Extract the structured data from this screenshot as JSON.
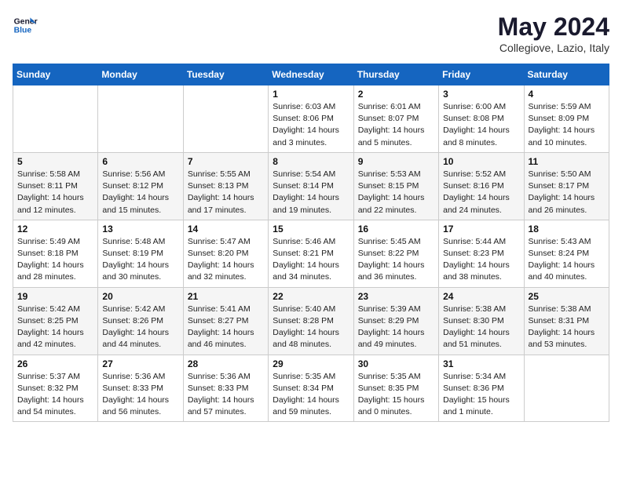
{
  "header": {
    "logo_line1": "General",
    "logo_line2": "Blue",
    "month_title": "May 2024",
    "subtitle": "Collegiove, Lazio, Italy"
  },
  "weekdays": [
    "Sunday",
    "Monday",
    "Tuesday",
    "Wednesday",
    "Thursday",
    "Friday",
    "Saturday"
  ],
  "weeks": [
    [
      {
        "day": "",
        "sunrise": "",
        "sunset": "",
        "daylight": ""
      },
      {
        "day": "",
        "sunrise": "",
        "sunset": "",
        "daylight": ""
      },
      {
        "day": "",
        "sunrise": "",
        "sunset": "",
        "daylight": ""
      },
      {
        "day": "1",
        "sunrise": "Sunrise: 6:03 AM",
        "sunset": "Sunset: 8:06 PM",
        "daylight": "Daylight: 14 hours and 3 minutes."
      },
      {
        "day": "2",
        "sunrise": "Sunrise: 6:01 AM",
        "sunset": "Sunset: 8:07 PM",
        "daylight": "Daylight: 14 hours and 5 minutes."
      },
      {
        "day": "3",
        "sunrise": "Sunrise: 6:00 AM",
        "sunset": "Sunset: 8:08 PM",
        "daylight": "Daylight: 14 hours and 8 minutes."
      },
      {
        "day": "4",
        "sunrise": "Sunrise: 5:59 AM",
        "sunset": "Sunset: 8:09 PM",
        "daylight": "Daylight: 14 hours and 10 minutes."
      }
    ],
    [
      {
        "day": "5",
        "sunrise": "Sunrise: 5:58 AM",
        "sunset": "Sunset: 8:11 PM",
        "daylight": "Daylight: 14 hours and 12 minutes."
      },
      {
        "day": "6",
        "sunrise": "Sunrise: 5:56 AM",
        "sunset": "Sunset: 8:12 PM",
        "daylight": "Daylight: 14 hours and 15 minutes."
      },
      {
        "day": "7",
        "sunrise": "Sunrise: 5:55 AM",
        "sunset": "Sunset: 8:13 PM",
        "daylight": "Daylight: 14 hours and 17 minutes."
      },
      {
        "day": "8",
        "sunrise": "Sunrise: 5:54 AM",
        "sunset": "Sunset: 8:14 PM",
        "daylight": "Daylight: 14 hours and 19 minutes."
      },
      {
        "day": "9",
        "sunrise": "Sunrise: 5:53 AM",
        "sunset": "Sunset: 8:15 PM",
        "daylight": "Daylight: 14 hours and 22 minutes."
      },
      {
        "day": "10",
        "sunrise": "Sunrise: 5:52 AM",
        "sunset": "Sunset: 8:16 PM",
        "daylight": "Daylight: 14 hours and 24 minutes."
      },
      {
        "day": "11",
        "sunrise": "Sunrise: 5:50 AM",
        "sunset": "Sunset: 8:17 PM",
        "daylight": "Daylight: 14 hours and 26 minutes."
      }
    ],
    [
      {
        "day": "12",
        "sunrise": "Sunrise: 5:49 AM",
        "sunset": "Sunset: 8:18 PM",
        "daylight": "Daylight: 14 hours and 28 minutes."
      },
      {
        "day": "13",
        "sunrise": "Sunrise: 5:48 AM",
        "sunset": "Sunset: 8:19 PM",
        "daylight": "Daylight: 14 hours and 30 minutes."
      },
      {
        "day": "14",
        "sunrise": "Sunrise: 5:47 AM",
        "sunset": "Sunset: 8:20 PM",
        "daylight": "Daylight: 14 hours and 32 minutes."
      },
      {
        "day": "15",
        "sunrise": "Sunrise: 5:46 AM",
        "sunset": "Sunset: 8:21 PM",
        "daylight": "Daylight: 14 hours and 34 minutes."
      },
      {
        "day": "16",
        "sunrise": "Sunrise: 5:45 AM",
        "sunset": "Sunset: 8:22 PM",
        "daylight": "Daylight: 14 hours and 36 minutes."
      },
      {
        "day": "17",
        "sunrise": "Sunrise: 5:44 AM",
        "sunset": "Sunset: 8:23 PM",
        "daylight": "Daylight: 14 hours and 38 minutes."
      },
      {
        "day": "18",
        "sunrise": "Sunrise: 5:43 AM",
        "sunset": "Sunset: 8:24 PM",
        "daylight": "Daylight: 14 hours and 40 minutes."
      }
    ],
    [
      {
        "day": "19",
        "sunrise": "Sunrise: 5:42 AM",
        "sunset": "Sunset: 8:25 PM",
        "daylight": "Daylight: 14 hours and 42 minutes."
      },
      {
        "day": "20",
        "sunrise": "Sunrise: 5:42 AM",
        "sunset": "Sunset: 8:26 PM",
        "daylight": "Daylight: 14 hours and 44 minutes."
      },
      {
        "day": "21",
        "sunrise": "Sunrise: 5:41 AM",
        "sunset": "Sunset: 8:27 PM",
        "daylight": "Daylight: 14 hours and 46 minutes."
      },
      {
        "day": "22",
        "sunrise": "Sunrise: 5:40 AM",
        "sunset": "Sunset: 8:28 PM",
        "daylight": "Daylight: 14 hours and 48 minutes."
      },
      {
        "day": "23",
        "sunrise": "Sunrise: 5:39 AM",
        "sunset": "Sunset: 8:29 PM",
        "daylight": "Daylight: 14 hours and 49 minutes."
      },
      {
        "day": "24",
        "sunrise": "Sunrise: 5:38 AM",
        "sunset": "Sunset: 8:30 PM",
        "daylight": "Daylight: 14 hours and 51 minutes."
      },
      {
        "day": "25",
        "sunrise": "Sunrise: 5:38 AM",
        "sunset": "Sunset: 8:31 PM",
        "daylight": "Daylight: 14 hours and 53 minutes."
      }
    ],
    [
      {
        "day": "26",
        "sunrise": "Sunrise: 5:37 AM",
        "sunset": "Sunset: 8:32 PM",
        "daylight": "Daylight: 14 hours and 54 minutes."
      },
      {
        "day": "27",
        "sunrise": "Sunrise: 5:36 AM",
        "sunset": "Sunset: 8:33 PM",
        "daylight": "Daylight: 14 hours and 56 minutes."
      },
      {
        "day": "28",
        "sunrise": "Sunrise: 5:36 AM",
        "sunset": "Sunset: 8:33 PM",
        "daylight": "Daylight: 14 hours and 57 minutes."
      },
      {
        "day": "29",
        "sunrise": "Sunrise: 5:35 AM",
        "sunset": "Sunset: 8:34 PM",
        "daylight": "Daylight: 14 hours and 59 minutes."
      },
      {
        "day": "30",
        "sunrise": "Sunrise: 5:35 AM",
        "sunset": "Sunset: 8:35 PM",
        "daylight": "Daylight: 15 hours and 0 minutes."
      },
      {
        "day": "31",
        "sunrise": "Sunrise: 5:34 AM",
        "sunset": "Sunset: 8:36 PM",
        "daylight": "Daylight: 15 hours and 1 minute."
      },
      {
        "day": "",
        "sunrise": "",
        "sunset": "",
        "daylight": ""
      }
    ]
  ]
}
